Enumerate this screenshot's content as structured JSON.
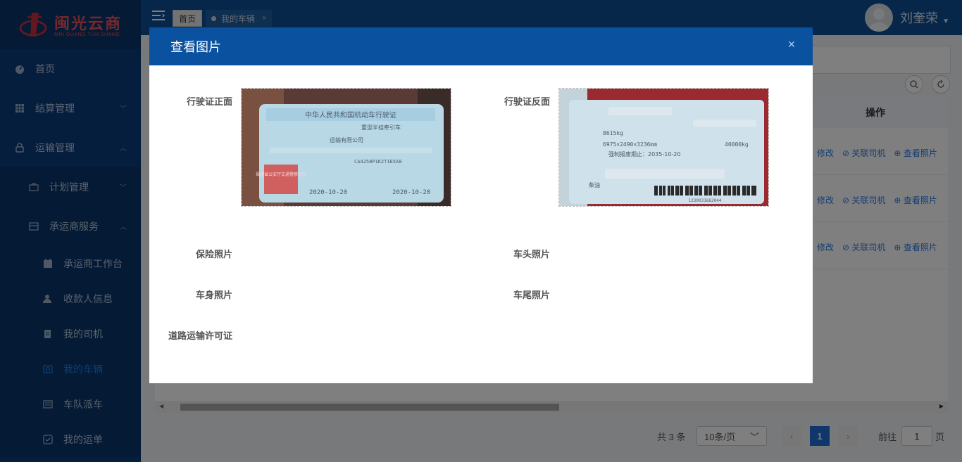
{
  "logo": {
    "cn": "闽光云商",
    "en": "MIN GUANG YUN SHANG"
  },
  "sidebar": {
    "items": [
      {
        "label": "首页",
        "icon": "dashboard-icon"
      },
      {
        "label": "结算管理",
        "icon": "grid-icon"
      },
      {
        "label": "运输管理",
        "icon": "lock-icon"
      },
      {
        "label": "计划管理",
        "icon": "briefcase-icon"
      },
      {
        "label": "承运商服务",
        "icon": "card-icon"
      },
      {
        "label": "承运商工作台",
        "icon": "calendar-icon"
      },
      {
        "label": "收款人信息",
        "icon": "user-icon"
      },
      {
        "label": "我的司机",
        "icon": "document-icon"
      },
      {
        "label": "我的车辆",
        "icon": "camera-icon"
      },
      {
        "label": "车队派车",
        "icon": "list-icon"
      },
      {
        "label": "我的运单",
        "icon": "checkbox-icon"
      }
    ]
  },
  "tabs": {
    "home": "首页",
    "current": "我的车辆",
    "close": "×"
  },
  "user": {
    "name": "刘奎荣"
  },
  "table": {
    "op_header": "操作",
    "ops": {
      "edit": "修改",
      "link_driver": "关联司机",
      "view_photo": "查看照片"
    }
  },
  "pager": {
    "total": "共 3 条",
    "size": "10条/页",
    "current": "1",
    "goto": "前往",
    "input": "1",
    "page": "页"
  },
  "modal": {
    "title": "查看图片",
    "close": "×",
    "labels": {
      "license_front": "行驶证正面",
      "license_back": "行驶证反面",
      "insurance": "保险照片",
      "head": "车头照片",
      "body": "车身照片",
      "tail": "车尾照片",
      "permit": "道路运输许可证"
    },
    "front_card": {
      "title": "中华人民共和国机动车行驶证",
      "vehicle_type": "重型半挂牵引车",
      "agency": "运输有限公司",
      "vin": "CA4258P1K2T1E5A8",
      "reg_date": "2020-10-20",
      "issue_date": "2020-10-20",
      "stamp": "福建省公安厅交通警察总队"
    },
    "back_card": {
      "weight": "8615kg",
      "dims": "6975×2490×3236mm",
      "tow": "40000kg",
      "scrap": "强制报废期止：2035-10-20",
      "fuel": "柴油",
      "barcode": "1330031662044"
    }
  }
}
